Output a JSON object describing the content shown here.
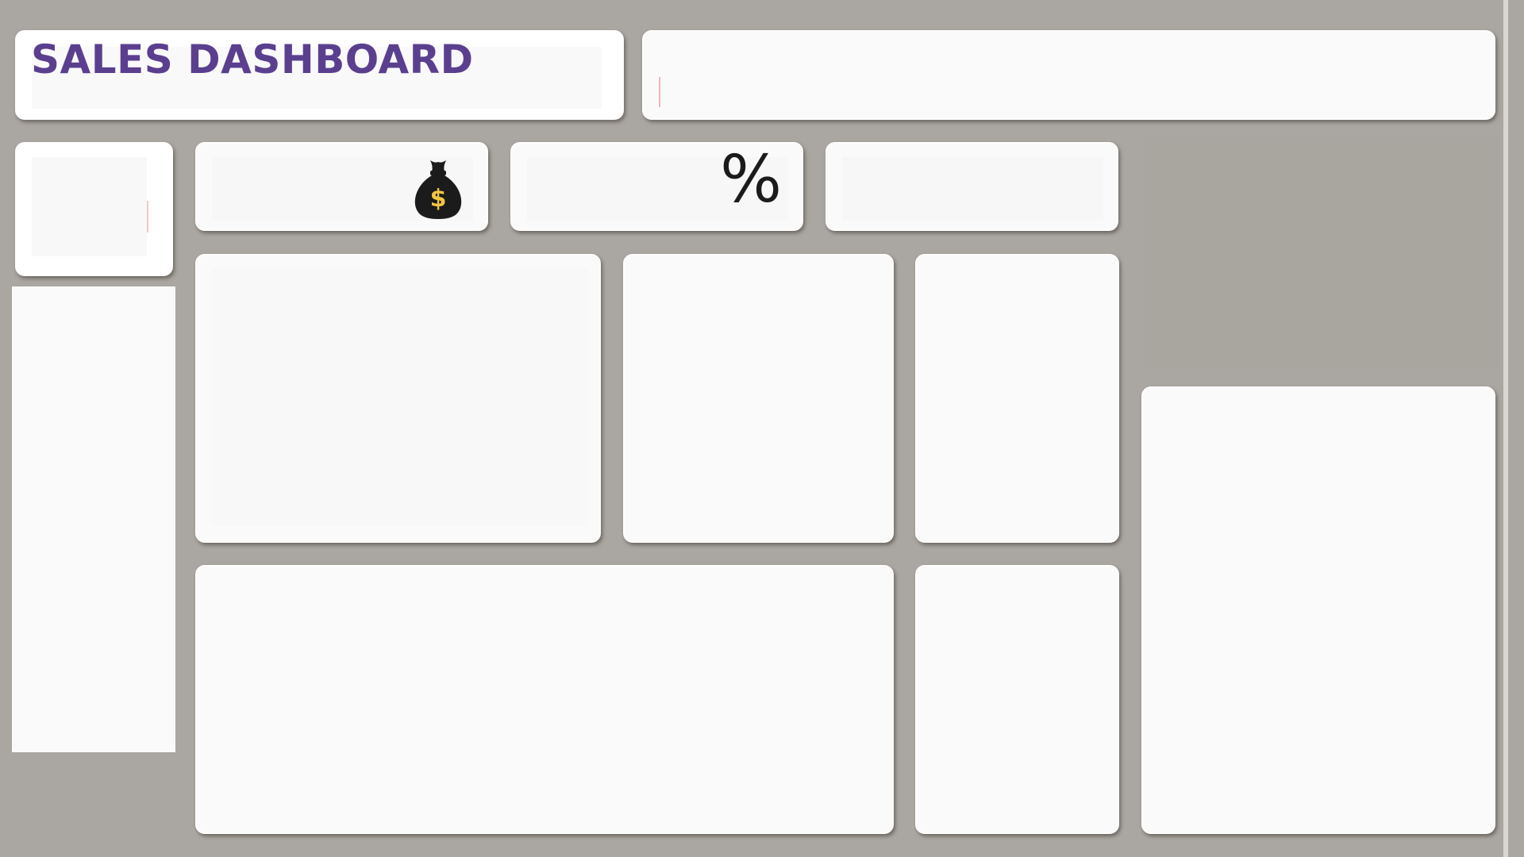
{
  "dashboard": {
    "title": "SALES DASHBOARD"
  },
  "header": {
    "filter_bar_label": ""
  },
  "kpis": [
    {
      "icon": "money-bag-icon",
      "symbol": "$",
      "label": ""
    },
    {
      "icon": "percent-icon",
      "symbol": "%",
      "label": ""
    },
    {
      "icon": "",
      "symbol": "",
      "label": ""
    }
  ],
  "colors": {
    "background": "#aaa6a1",
    "card": "#fafafa",
    "title": "#5b3f8f",
    "bag": "#1b1b1b",
    "dollar": "#f3c641"
  }
}
